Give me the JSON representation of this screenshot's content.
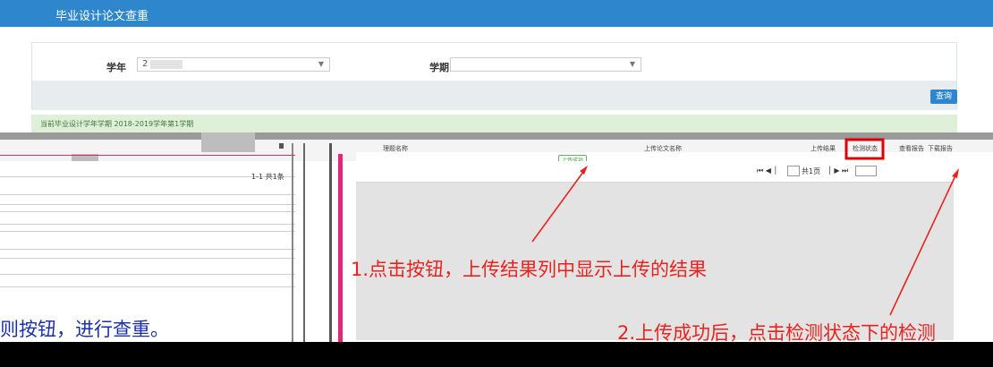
{
  "header": {
    "title": "毕业设计论文查重"
  },
  "filter": {
    "year_label": "学年",
    "year_value": "2",
    "semester_label": "学期",
    "semester_value": "",
    "query_button": "查询"
  },
  "info": {
    "text": "当前毕业设计学年学期 2018-2019学年第1学期"
  },
  "left_grid": {
    "range_text": "1-1  共1条"
  },
  "columns": [
    "理题名称",
    "上传论文名称",
    "上传结果",
    "检测状态",
    "查看报告",
    "下载报告"
  ],
  "upload_tag": "上传成功",
  "right_grid": {
    "pager": {
      "total_pages_text": "共1页"
    }
  },
  "annotations": {
    "step1": "1.点击按钮，上传结果列中显示上传的结果",
    "step2": "2.上传成功后，点击检测状态下的检测",
    "step_left": "则按钮，进行查重。"
  },
  "colors": {
    "header": "#2e87cc",
    "annotation_red": "#e8231f",
    "annotation_blue": "#1a2fb0",
    "highlight_box": "#e00000"
  }
}
